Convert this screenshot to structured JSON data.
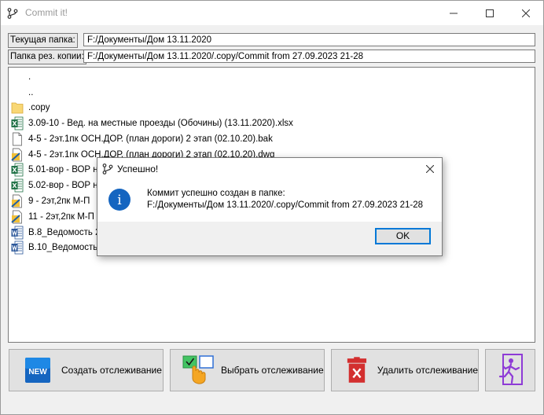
{
  "window": {
    "title": "Commit it!",
    "controls": [
      "minimize-icon",
      "maximize-icon",
      "close-icon"
    ]
  },
  "fields": {
    "current_folder_label": "Текущая папка:",
    "current_folder_value": "F:/Документы/Дом 13.11.2020",
    "backup_folder_label": "Папка рез. копии:",
    "backup_folder_value": "F:/Документы/Дом 13.11.2020/.copy/Commit from 27.09.2023 21-28"
  },
  "file_list": [
    {
      "name": ".",
      "icon": "none"
    },
    {
      "name": "..",
      "icon": "none"
    },
    {
      "name": ".copy",
      "icon": "folder-icon"
    },
    {
      "name": "3.09-10 - Вед. на местные проезды (Обочины) (13.11.2020).xlsx",
      "icon": "excel-icon"
    },
    {
      "name": "4-5 - 2эт.1пк ОСН.ДОР. (план дороги) 2 этап (02.10.20).bak",
      "icon": "file-icon"
    },
    {
      "name": "4-5 - 2эт.1пк ОСН.ДОР. (план дороги) 2 этап (02.10.20).dwg",
      "icon": "dwg-icon"
    },
    {
      "name": "5.01-вор - ВОР н",
      "icon": "excel-icon"
    },
    {
      "name": "5.02-вор - ВОР н",
      "icon": "excel-icon"
    },
    {
      "name": "9 - 2эт,2пк М-П",
      "icon": "dwg-icon"
    },
    {
      "name": "11 - 2эт,2пк М-П",
      "icon": "dwg-icon"
    },
    {
      "name": "В.8_Ведомость 2",
      "icon": "word-icon"
    },
    {
      "name": "В.10_Ведомость",
      "icon": "word-icon"
    }
  ],
  "buttons": {
    "create": {
      "label": "Создать отслеживание",
      "badge": "NEW"
    },
    "select": {
      "label": "Выбрать отслеживание"
    },
    "delete": {
      "label": "Удалить отслеживание"
    },
    "exit": {
      "label": ""
    }
  },
  "dialog": {
    "title": "Успешно!",
    "message_line1": "Коммит успешно создан в папке:",
    "message_line2": "F:/Документы/Дом 13.11.2020/.copy/Commit from 27.09.2023 21-28",
    "ok_label": "OK",
    "info_glyph": "i"
  },
  "colors": {
    "accent": "#0078d7",
    "excel_green": "#1e7145",
    "word_blue": "#2b579a",
    "folder_yellow": "#f8d775",
    "new_badge_blue": "#1565c0",
    "delete_red": "#d32f2f",
    "exit_purple": "#8e3bd6"
  }
}
